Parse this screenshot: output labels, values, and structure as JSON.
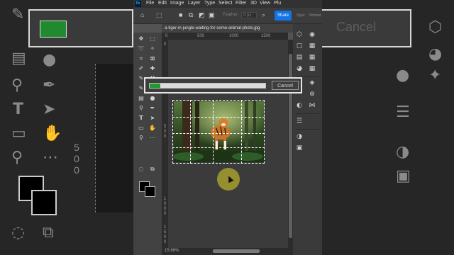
{
  "app": {
    "logo": "Ps",
    "menu": [
      "File",
      "Edit",
      "Image",
      "Layer",
      "Type",
      "Select",
      "Filter",
      "3D",
      "View",
      "Plu"
    ]
  },
  "options": {
    "feather_label": "Feather:",
    "feather_value": "0 px",
    "share_label": "Share",
    "extra_labels": [
      "Style:",
      "Normal"
    ]
  },
  "document": {
    "tab_title": "a-tiger-in-jungle-waiting-for-some-animal-photo.jpg",
    "zoom": "15.86%"
  },
  "rulers": {
    "top": [
      "0",
      "500",
      "1000",
      "1500"
    ],
    "left": [
      "0",
      "5",
      "0",
      "0",
      "1",
      "0",
      "0",
      "0",
      "1",
      "5",
      "0",
      "0"
    ]
  },
  "dialog": {
    "progress_percent": 3,
    "cancel_label": "Cancel"
  },
  "background": {
    "cancel_label": "Cancel",
    "progress_percent": 3,
    "ruler_digits": [
      "5",
      "0",
      "0"
    ]
  },
  "colors": {
    "accent": "#1473e6",
    "progress": "#1e9a31",
    "cursor_highlight": "#e2d628"
  },
  "tools": [
    "move-icon",
    "marquee-icon",
    "lasso-icon",
    "magic-wand-icon",
    "crop-icon",
    "frame-icon",
    "eyedropper-icon",
    "healing-icon",
    "brush-icon",
    "stamp-icon",
    "history-brush-icon",
    "eraser-icon",
    "gradient-icon",
    "blur-icon",
    "dodge-icon",
    "pen-icon",
    "type-icon",
    "path-select-icon",
    "rectangle-icon",
    "hand-icon",
    "zoom-icon",
    "more-icon"
  ],
  "panel_icons": [
    "layers-icon",
    "libraries-icon",
    "properties-icon",
    "adjustments-icon",
    "channels-icon",
    "paths-icon",
    "color-icon",
    "swatches-icon"
  ]
}
